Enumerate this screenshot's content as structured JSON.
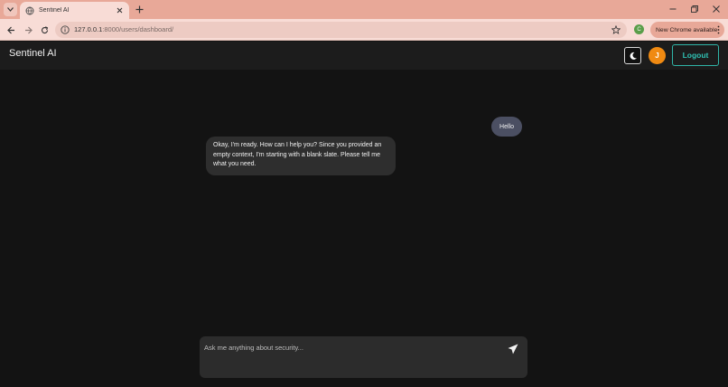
{
  "browser": {
    "tab": {
      "title": "Sentinel AI"
    },
    "address_bar": {
      "url_host": "127.0.0.1",
      "url_rest": ":8000/users/dashboard/"
    },
    "profile_initial": "C",
    "update_chip": {
      "label": "New Chrome available"
    }
  },
  "header": {
    "brand": "Sentinel AI",
    "avatar_initial": "J",
    "logout_label": "Logout"
  },
  "chat": {
    "messages": [
      {
        "role": "user",
        "text": "Hello"
      },
      {
        "role": "assistant",
        "text": "Okay, I'm ready. How can I help you? Since you provided an empty context, I'm starting with a blank slate. Please tell me what you need."
      }
    ],
    "input": {
      "placeholder": "Ask me anything about security...",
      "value": ""
    }
  },
  "colors": {
    "background": "#131313",
    "header": "#1c1c1c",
    "accent": "#2fc2b4",
    "avatar": "#f08a12",
    "user_bubble": "#4b4f62",
    "assistant_bubble": "#2e2e2e"
  },
  "icons": [
    "tab-list-icon",
    "globe-icon",
    "close-icon",
    "plus-icon",
    "minimize-icon",
    "restore-icon",
    "back-icon",
    "forward-icon",
    "reload-icon",
    "site-info-icon",
    "star-icon",
    "kebab-menu-icon",
    "moon-icon",
    "send-icon"
  ]
}
